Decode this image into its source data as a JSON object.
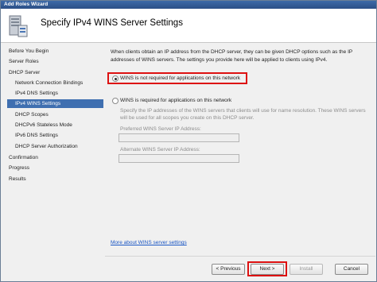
{
  "window": {
    "title": "Add Roles Wizard"
  },
  "header": {
    "title": "Specify IPv4 WINS Server Settings",
    "icon": "server-roles-icon"
  },
  "nav": {
    "items": [
      {
        "label": "Before You Begin",
        "level": "top",
        "state": "normal"
      },
      {
        "label": "Server Roles",
        "level": "top",
        "state": "normal"
      },
      {
        "label": "DHCP Server",
        "level": "top",
        "state": "normal"
      },
      {
        "label": "Network Connection Bindings",
        "level": "sub",
        "state": "normal"
      },
      {
        "label": "IPv4 DNS Settings",
        "level": "sub",
        "state": "normal"
      },
      {
        "label": "IPv4 WINS Settings",
        "level": "sub",
        "state": "active"
      },
      {
        "label": "DHCP Scopes",
        "level": "sub",
        "state": "normal"
      },
      {
        "label": "DHCPv6 Stateless Mode",
        "level": "sub",
        "state": "normal"
      },
      {
        "label": "IPv6 DNS Settings",
        "level": "sub",
        "state": "normal"
      },
      {
        "label": "DHCP Server Authorization",
        "level": "sub",
        "state": "normal"
      },
      {
        "label": "Confirmation",
        "level": "top",
        "state": "normal"
      },
      {
        "label": "Progress",
        "level": "top",
        "state": "normal"
      },
      {
        "label": "Results",
        "level": "top",
        "state": "normal"
      }
    ]
  },
  "content": {
    "description": "When clients obtain an IP address from the DHCP server, they can be given DHCP options such as the IP addresses of WINS servers. The settings you provide here will be applied to clients using IPv4.",
    "option_not_required": {
      "label": "WINS is not required for applications on this network",
      "selected": true
    },
    "option_required": {
      "label": "WINS is required for applications on this network",
      "selected": false
    },
    "required_description": "Specify the IP addresses of the WINS servers that clients will use for name resolution. These WINS servers will be used for all scopes you create on this DHCP server.",
    "preferred_label": "Preferred WINS Server IP Address:",
    "preferred_value": "",
    "alternate_label": "Alternate WINS Server IP Address:",
    "alternate_value": "",
    "more_link": "More about WINS server settings"
  },
  "buttons": {
    "previous": "< Previous",
    "next": "Next >",
    "install": "Install",
    "cancel": "Cancel"
  },
  "colors": {
    "highlight": "#dd1111",
    "active_nav": "#3f6fb0",
    "link": "#1a56c4"
  }
}
